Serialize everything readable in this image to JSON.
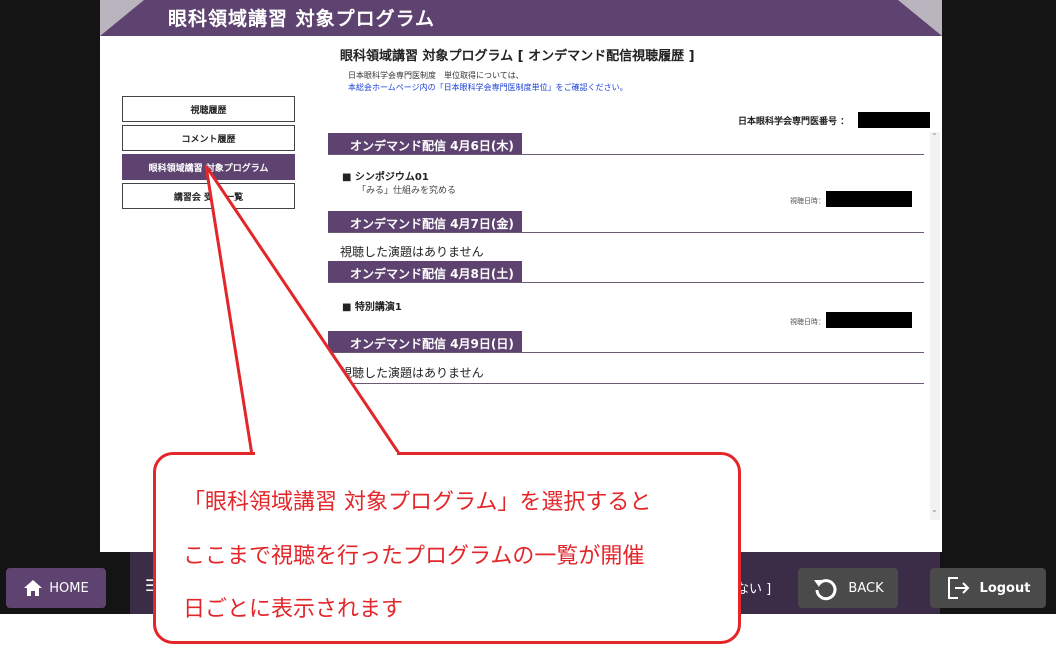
{
  "header": {
    "title": "眼科領域講習 対象プログラム"
  },
  "page": {
    "title": "眼科領域講習 対象プログラム [ オンデマンド配信視聴履歴 ]",
    "note_line1": "日本眼科学会専門医制度　単位取得については、",
    "note_line2": "本総会ホームページ内の「日本眼科学会専門医制度単位」をご確認ください。"
  },
  "sidebar": {
    "items": [
      {
        "label": "視聴履歴"
      },
      {
        "label": "コメント履歴"
      },
      {
        "label": "眼科領域講習 対象プログラム"
      },
      {
        "label": "講習会 受講 一覧"
      }
    ]
  },
  "member": {
    "label": "日本眼科学会専門医番号 ："
  },
  "days": [
    {
      "label": "オンデマンド配信 4月6日(木)",
      "programs": [
        {
          "title": "■ シンポジウム01",
          "subtitle": "「みる」仕組みを究める",
          "view_date_label": "視聴日時："
        }
      ],
      "empty": ""
    },
    {
      "label": "オンデマンド配信 4月7日(金)",
      "programs": [],
      "empty": "視聴した演題はありません"
    },
    {
      "label": "オンデマンド配信 4月8日(土)",
      "programs": [
        {
          "title": "■ 特別講演1",
          "subtitle": "",
          "view_date_label": "視聴日時："
        }
      ],
      "empty": ""
    },
    {
      "label": "オンデマンド配信 4月9日(日)",
      "programs": [],
      "empty": "視聴した演題はありません"
    }
  ],
  "footer": {
    "home_label": "HOME",
    "back_label": "BACK",
    "logout_label": "Logout",
    "partial_text": "ない ]"
  },
  "callout": {
    "line1": "「眼科領域講習 対象プログラム」を選択すると",
    "line2": "ここまで視聴を行ったプログラムの一覧が開催",
    "line3": "日ごとに表示されます"
  },
  "colors": {
    "accent": "#5e4370",
    "callout": "#e3262a",
    "link": "#1a3fd6"
  },
  "icons": {
    "home": "home-icon",
    "back": "back-arrow-icon",
    "logout": "logout-icon",
    "list": "list-icon"
  }
}
